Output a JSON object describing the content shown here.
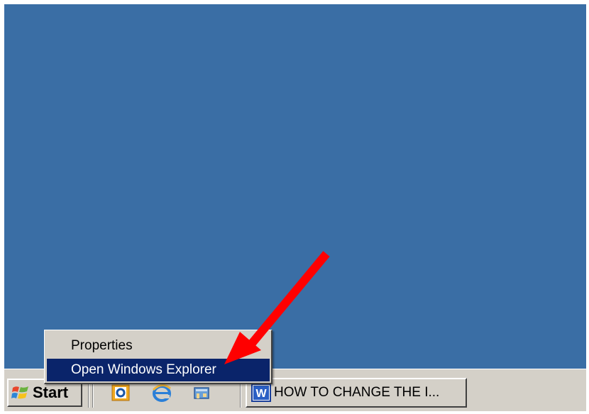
{
  "desktop": {
    "background_color": "#3a6ea5"
  },
  "taskbar": {
    "start_label": "Start",
    "start_icon": "windows-flag-icon",
    "quick_launch": [
      {
        "icon": "outlook-icon"
      },
      {
        "icon": "internet-explorer-icon"
      },
      {
        "icon": "show-desktop-icon"
      }
    ],
    "task_button": {
      "icon": "word-icon",
      "label": "HOW TO CHANGE THE I..."
    }
  },
  "context_menu": {
    "items": [
      {
        "label": "Properties",
        "highlighted": false
      },
      {
        "label": "Open Windows Explorer",
        "highlighted": true
      }
    ],
    "highlight_color": "#0a246a"
  },
  "annotation": {
    "arrow_color": "#ff0000",
    "arrow_icon": "red-arrow-icon"
  }
}
